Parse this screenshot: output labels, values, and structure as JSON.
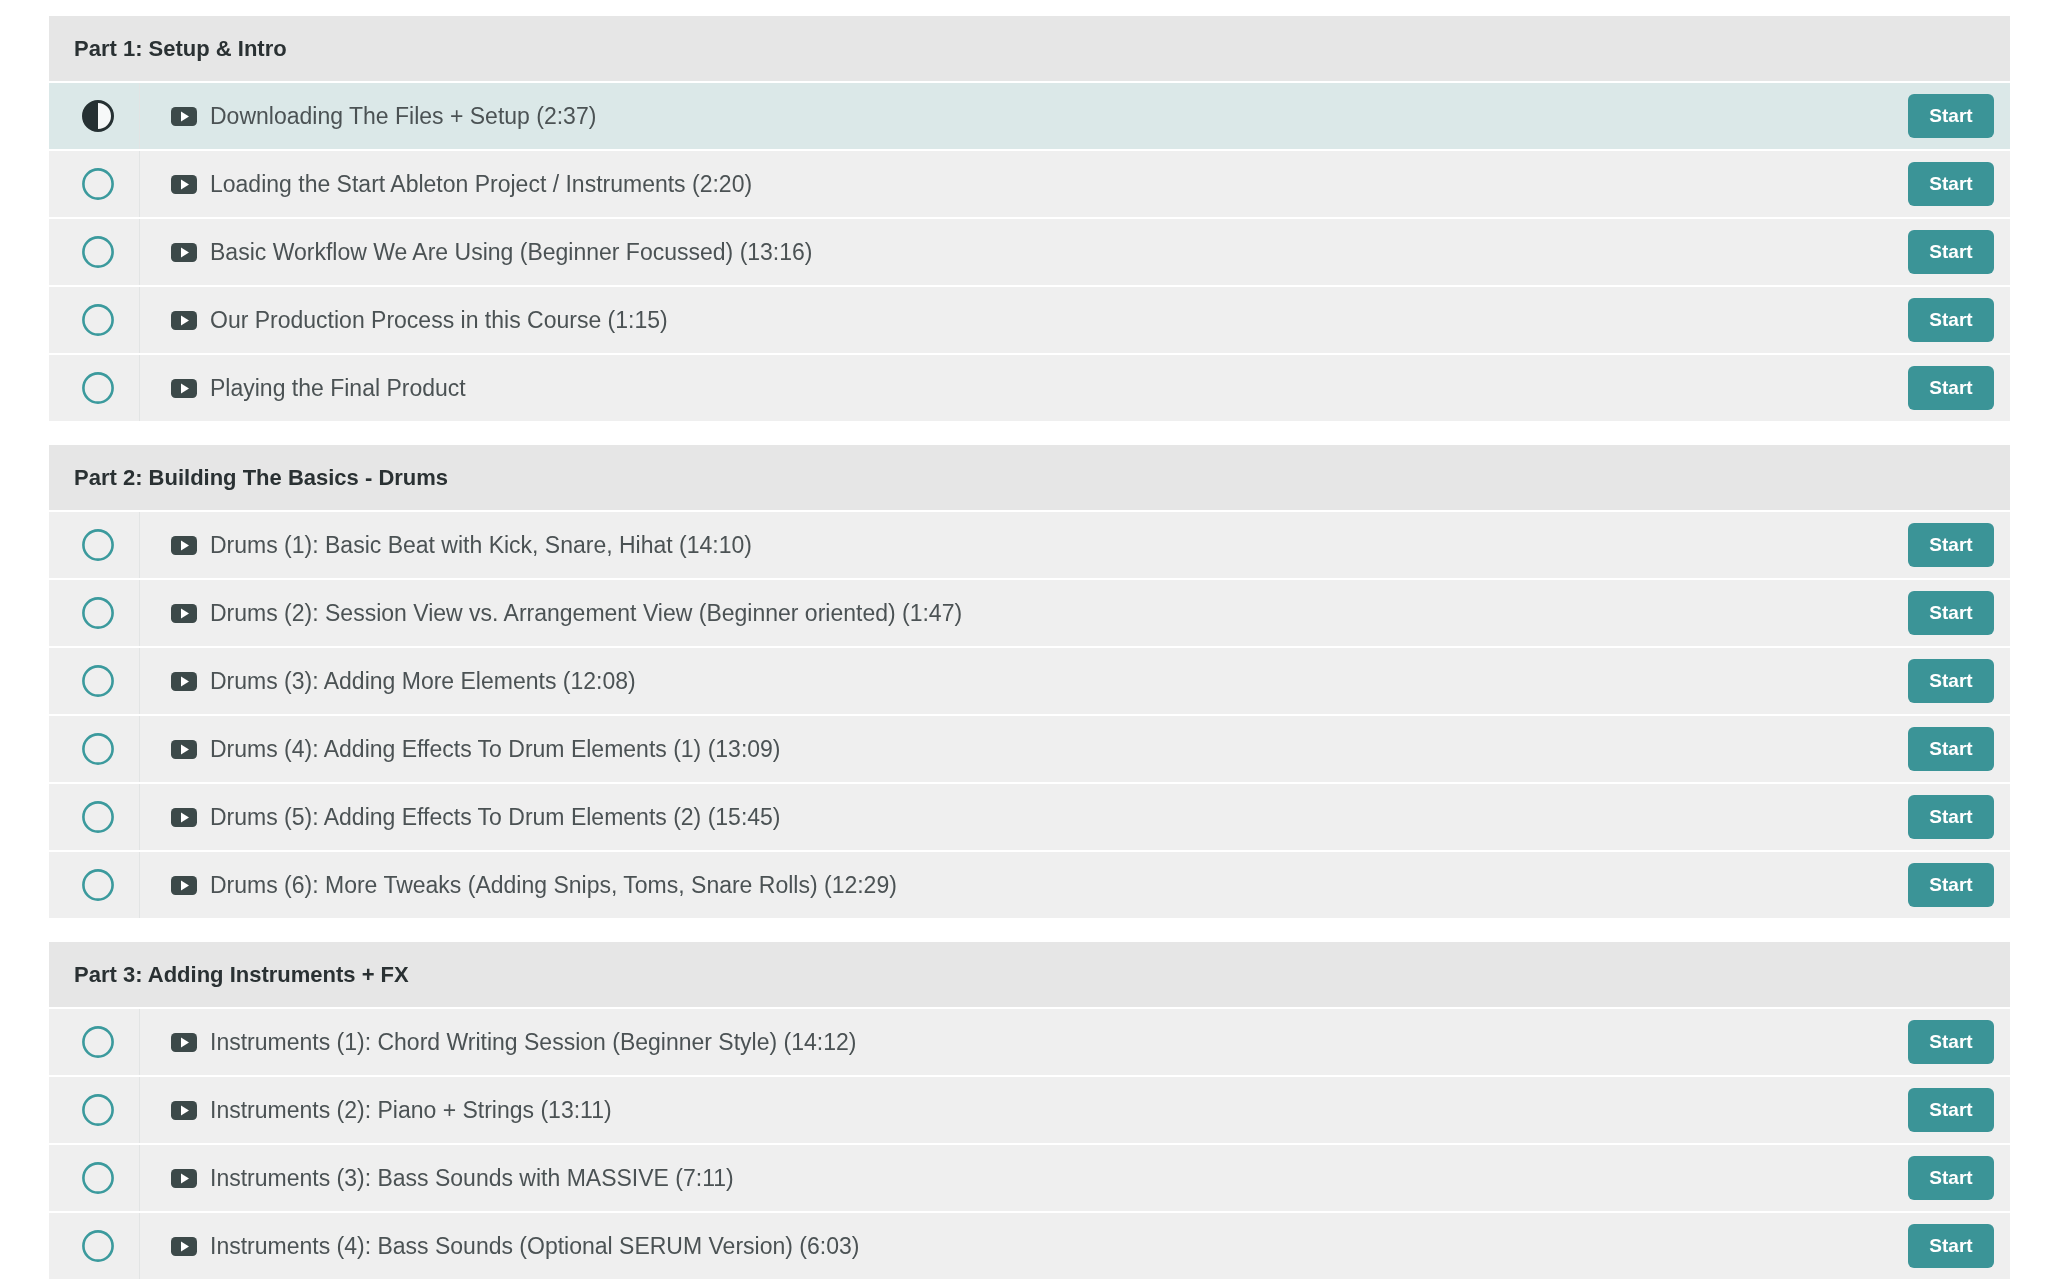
{
  "sections": [
    {
      "title": "Part 1: Setup & Intro",
      "lectures": [
        {
          "title": "Downloading The Files + Setup (2:37)",
          "in_progress": true,
          "selected": true,
          "button": "Start"
        },
        {
          "title": "Loading the Start Ableton Project / Instruments (2:20)",
          "in_progress": false,
          "selected": false,
          "button": "Start"
        },
        {
          "title": "Basic Workflow We Are Using (Beginner Focussed) (13:16)",
          "in_progress": false,
          "selected": false,
          "button": "Start"
        },
        {
          "title": "Our Production Process in this Course (1:15)",
          "in_progress": false,
          "selected": false,
          "button": "Start"
        },
        {
          "title": "Playing the Final Product",
          "in_progress": false,
          "selected": false,
          "button": "Start"
        }
      ]
    },
    {
      "title": "Part 2: Building The Basics - Drums",
      "lectures": [
        {
          "title": "Drums (1): Basic Beat with Kick, Snare, Hihat (14:10)",
          "in_progress": false,
          "selected": false,
          "button": "Start"
        },
        {
          "title": "Drums (2): Session View vs. Arrangement View (Beginner oriented) (1:47)",
          "in_progress": false,
          "selected": false,
          "button": "Start"
        },
        {
          "title": "Drums (3): Adding More Elements (12:08)",
          "in_progress": false,
          "selected": false,
          "button": "Start"
        },
        {
          "title": "Drums (4): Adding Effects To Drum Elements (1) (13:09)",
          "in_progress": false,
          "selected": false,
          "button": "Start"
        },
        {
          "title": "Drums (5): Adding Effects To Drum Elements (2) (15:45)",
          "in_progress": false,
          "selected": false,
          "button": "Start"
        },
        {
          "title": "Drums (6): More Tweaks (Adding Snips, Toms, Snare Rolls) (12:29)",
          "in_progress": false,
          "selected": false,
          "button": "Start"
        }
      ]
    },
    {
      "title": "Part 3: Adding Instruments + FX",
      "lectures": [
        {
          "title": "Instruments (1): Chord Writing Session (Beginner Style) (14:12)",
          "in_progress": false,
          "selected": false,
          "button": "Start"
        },
        {
          "title": "Instruments (2): Piano + Strings (13:11)",
          "in_progress": false,
          "selected": false,
          "button": "Start"
        },
        {
          "title": "Instruments (3): Bass Sounds with MASSIVE (7:11)",
          "in_progress": false,
          "selected": false,
          "button": "Start"
        },
        {
          "title": "Instruments (4): Bass Sounds (Optional SERUM Version) (6:03)",
          "in_progress": false,
          "selected": false,
          "button": "Start"
        }
      ]
    }
  ]
}
